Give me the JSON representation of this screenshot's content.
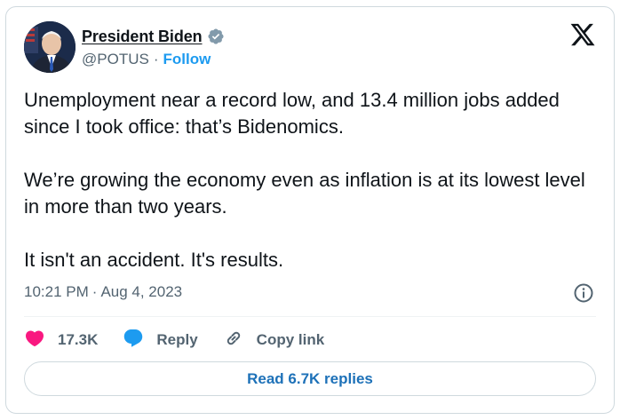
{
  "author": {
    "name": "President Biden",
    "handle": "@POTUS",
    "separator": "·",
    "follow_label": "Follow"
  },
  "tweet": {
    "paragraphs": [
      "Unemployment near a record low, and 13.4 million jobs added since I took office: that’s Bidenomics.",
      "We’re growing the economy even as inflation is at its lowest level in more than two years.",
      "It isn't an accident. It's results."
    ],
    "time": "10:21 PM",
    "separator": "·",
    "date": "Aug 4, 2023"
  },
  "actions": {
    "likes_count": "17.3K",
    "reply_label": "Reply",
    "copy_link_label": "Copy link"
  },
  "read_replies_label": "Read 6.7K replies",
  "icons": {
    "verified": "verified-badge-icon",
    "brand": "x-logo-icon",
    "info": "info-icon",
    "like": "heart-icon",
    "reply": "speech-bubble-icon",
    "copy_link": "link-icon"
  },
  "colors": {
    "text": "#0f1419",
    "secondary": "#536471",
    "accent": "#1d9bf0",
    "heart": "#f91880",
    "border": "#cfd9de",
    "verified": "#829aab"
  }
}
